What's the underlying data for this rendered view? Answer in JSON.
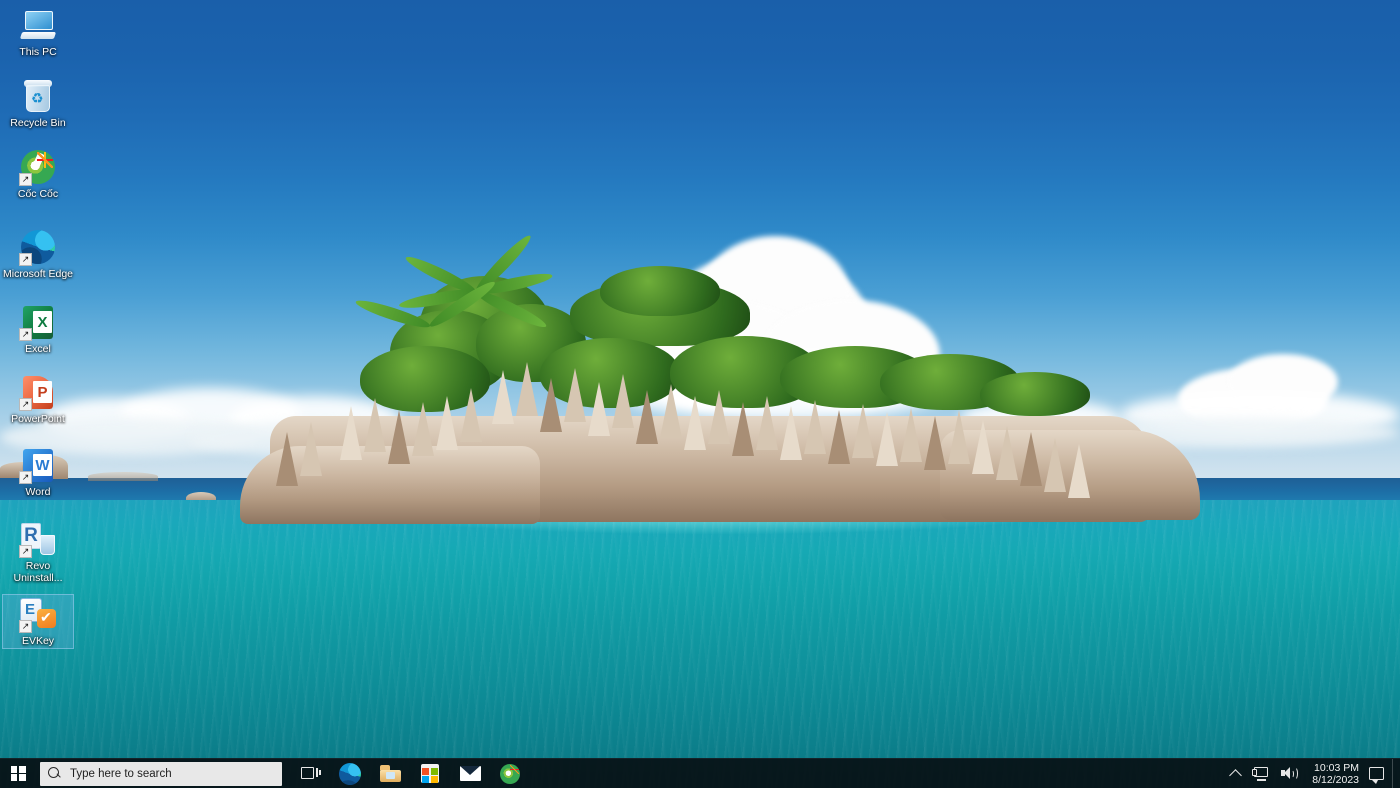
{
  "desktop": {
    "icons": [
      {
        "label": "This PC",
        "icon": "computer-icon",
        "selected": false
      },
      {
        "label": "Recycle Bin",
        "icon": "recycle-bin-icon",
        "selected": false
      },
      {
        "label": "Cốc Cốc",
        "icon": "coccoc-browser-icon",
        "selected": false
      },
      {
        "label": "Microsoft Edge",
        "icon": "microsoft-edge-icon",
        "selected": false
      },
      {
        "label": "Excel",
        "icon": "microsoft-excel-icon",
        "selected": false
      },
      {
        "label": "PowerPoint",
        "icon": "microsoft-powerpoint-icon",
        "selected": false
      },
      {
        "label": "Word",
        "icon": "microsoft-word-icon",
        "selected": false
      },
      {
        "label": "Revo Uninstall...",
        "icon": "revo-uninstaller-icon",
        "selected": false
      },
      {
        "label": "EVKey",
        "icon": "evkey-icon",
        "selected": true
      }
    ],
    "wallpaper": {
      "description": "Tropical island with granite rocks, palm trees, turquoise sea and cumulus clouds",
      "sky_color": "#1a5faa",
      "water_color": "#12a3ab",
      "rock_color": "#cdb9a4",
      "foliage_color": "#2f6b1e"
    }
  },
  "taskbar": {
    "background_color": "#081014",
    "start": {
      "name": "Start",
      "icon": "windows-logo-icon"
    },
    "search": {
      "placeholder": "Type here to search",
      "value": "",
      "icon": "search-icon",
      "background_color": "#e8e8e8"
    },
    "pinned": [
      {
        "label": "Task View",
        "icon": "task-view-icon"
      },
      {
        "label": "Microsoft Edge",
        "icon": "microsoft-edge-icon"
      },
      {
        "label": "File Explorer",
        "icon": "file-explorer-icon"
      },
      {
        "label": "Microsoft Store",
        "icon": "microsoft-store-icon"
      },
      {
        "label": "Mail",
        "icon": "mail-icon"
      },
      {
        "label": "Cốc Cốc",
        "icon": "coccoc-browser-icon"
      }
    ],
    "tray": {
      "show_hidden": {
        "label": "Show hidden icons",
        "icon": "chevron-up-icon"
      },
      "network": {
        "label": "Network",
        "icon": "network-icon"
      },
      "volume": {
        "label": "Volume",
        "icon": "speaker-icon"
      },
      "clock": {
        "time": "10:03 PM",
        "date": "8/12/2023"
      },
      "notifications": {
        "label": "Notifications",
        "icon": "notification-icon"
      },
      "show_desktop": {
        "label": "Show desktop"
      }
    }
  }
}
